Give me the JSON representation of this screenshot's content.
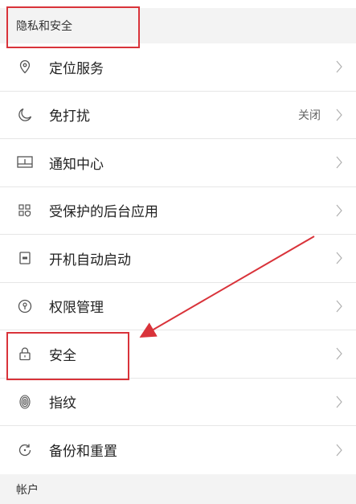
{
  "privacy_section": {
    "title": "隐私和安全"
  },
  "rows": [
    {
      "label": "定位服务",
      "icon": "location-pin-icon"
    },
    {
      "label": "免打扰",
      "value": "关闭",
      "icon": "moon-icon"
    },
    {
      "label": "通知中心",
      "icon": "notification-panel-icon"
    },
    {
      "label": "受保护的后台应用",
      "icon": "app-grid-shield-icon"
    },
    {
      "label": "开机自动启动",
      "icon": "power-on-toggle-icon"
    },
    {
      "label": "权限管理",
      "icon": "key-lock-icon"
    },
    {
      "label": "安全",
      "icon": "padlock-icon"
    },
    {
      "label": "指纹",
      "icon": "fingerprint-icon"
    },
    {
      "label": "备份和重置",
      "icon": "backup-restore-icon"
    }
  ],
  "account_section": {
    "title": "帐户"
  },
  "annotation_color": "#d9333a"
}
